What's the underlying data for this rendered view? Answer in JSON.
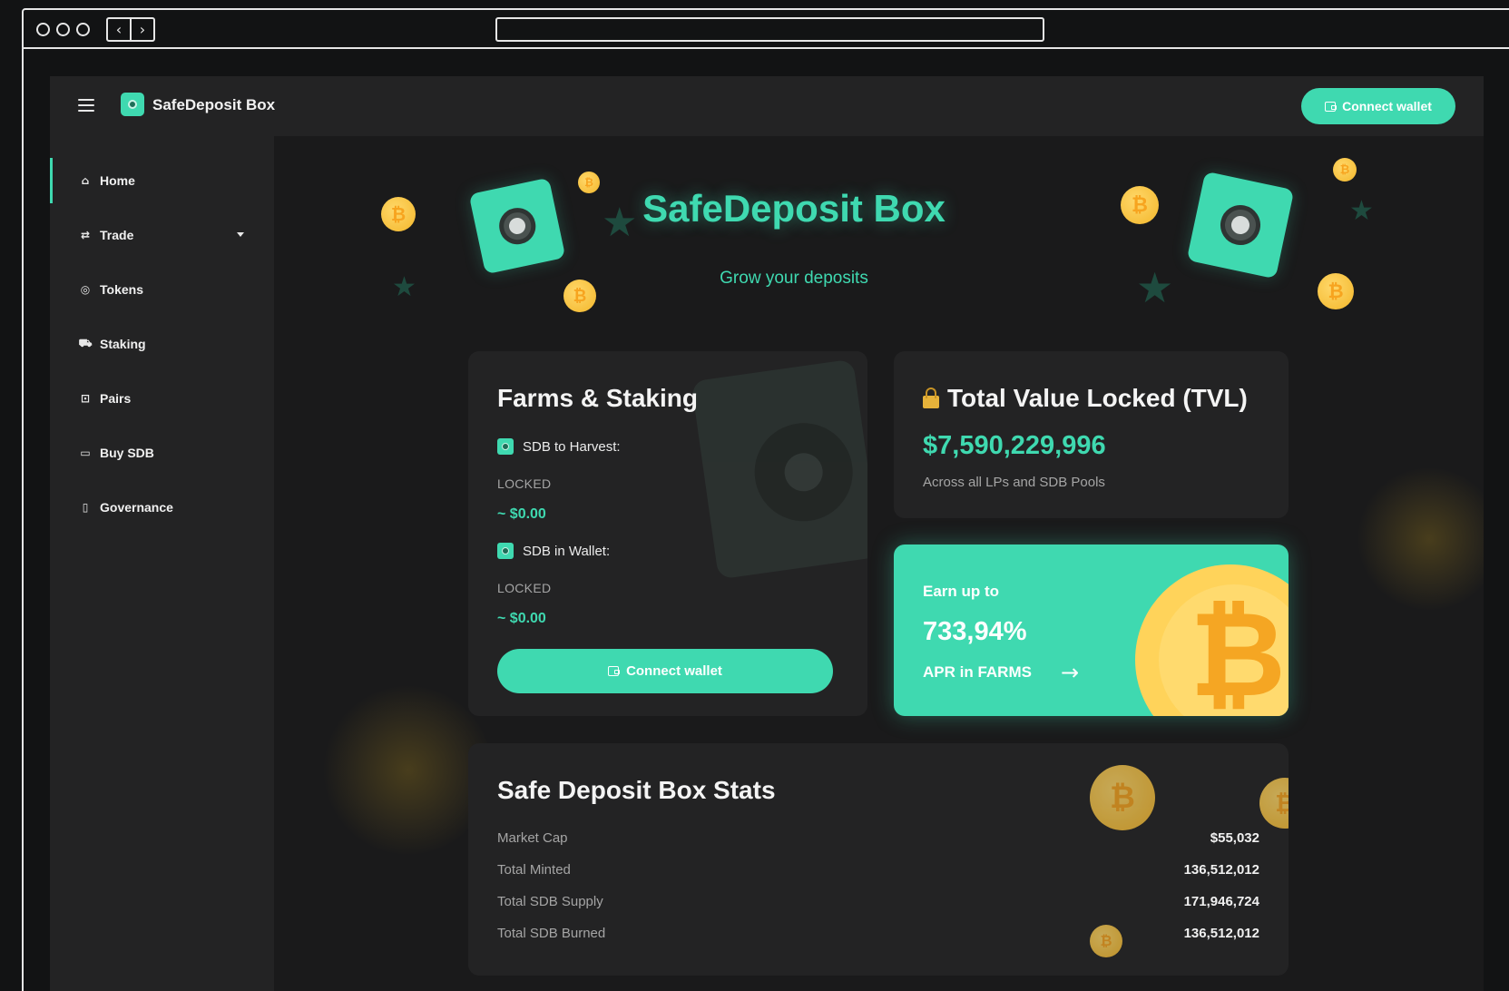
{
  "app": {
    "brand": "SafeDeposit Box",
    "connect_wallet_label": "Connect wallet"
  },
  "sidebar": {
    "items": [
      {
        "label": "Home",
        "icon": "home-icon",
        "active": true
      },
      {
        "label": "Trade",
        "icon": "swap-icon",
        "has_dropdown": true
      },
      {
        "label": "Tokens",
        "icon": "token-icon"
      },
      {
        "label": "Staking",
        "icon": "tractor-icon"
      },
      {
        "label": "Pairs",
        "icon": "safe-icon"
      },
      {
        "label": "Buy SDB",
        "icon": "card-icon"
      },
      {
        "label": "Governance",
        "icon": "clipboard-icon"
      }
    ]
  },
  "hero": {
    "title": "SafeDeposit Box",
    "subtitle": "Grow your deposits"
  },
  "farms": {
    "title": "Farms & Staking",
    "harvest_label": "SDB to Harvest:",
    "harvest_status": "LOCKED",
    "harvest_amount": "~ $0.00",
    "wallet_label": "SDB in Wallet:",
    "wallet_status": "LOCKED",
    "wallet_amount": "~ $0.00",
    "connect_label": "Connect wallet"
  },
  "tvl": {
    "title": "Total Value Locked (TVL)",
    "value": "$7,590,229,996",
    "note": "Across all LPs and SDB Pools"
  },
  "earn": {
    "prefix": "Earn up to",
    "value": "733,94%",
    "suffix": "APR in FARMS"
  },
  "stats": {
    "title": "Safe Deposit Box Stats",
    "rows": [
      {
        "label": "Market Cap",
        "value": "$55,032"
      },
      {
        "label": "Total Minted",
        "value": "136,512,012"
      },
      {
        "label": "Total SDB Supply",
        "value": "171,946,724"
      },
      {
        "label": "Total SDB Burned",
        "value": "136,512,012"
      }
    ]
  },
  "colors": {
    "accent": "#3fd9b0",
    "background": "#1a1a1b",
    "card": "#232324",
    "coin": "#ffd35a"
  }
}
